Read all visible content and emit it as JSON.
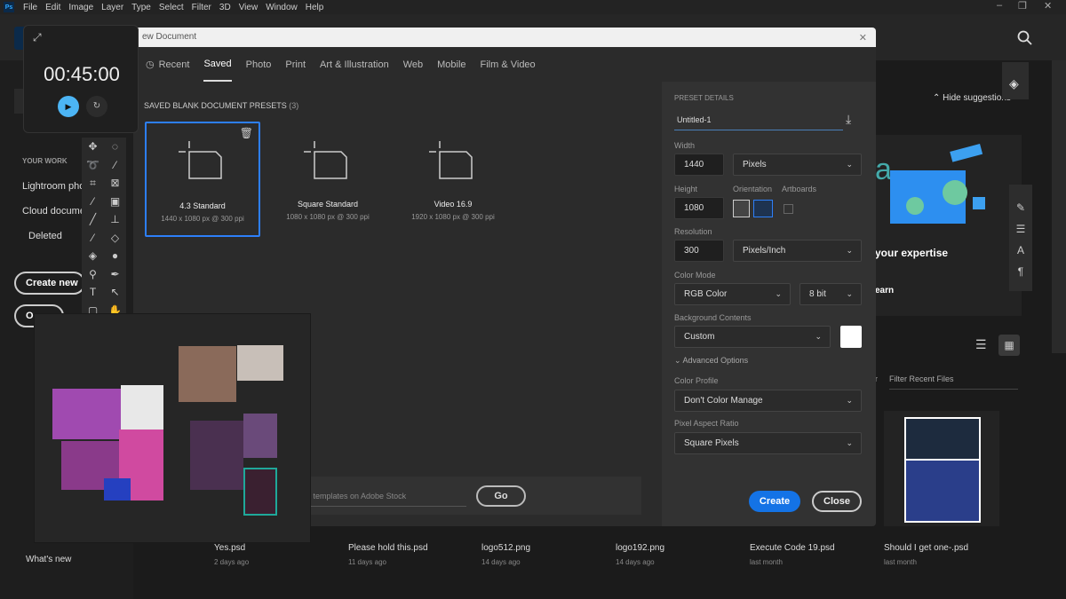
{
  "menubar": {
    "logo": "Ps",
    "items": [
      "File",
      "Edit",
      "Image",
      "Layer",
      "Type",
      "Select",
      "Filter",
      "3D",
      "View",
      "Window",
      "Help"
    ]
  },
  "window_controls": {
    "minimize": "–",
    "restore": "❐",
    "close": "✕"
  },
  "timer": {
    "time": "00:45:00",
    "play_icon": "play-icon",
    "reset_icon": "reset-icon"
  },
  "sidebar": {
    "section": "YOUR WORK",
    "items": [
      "Lightroom pho",
      "Cloud docume",
      "Deleted"
    ],
    "create_new": "Create new",
    "open": "O",
    "whats_new": "What's new"
  },
  "dialog": {
    "title": "ew Document",
    "close": "✕",
    "tabs": [
      {
        "label": "Recent"
      },
      {
        "label": "Saved",
        "active": true
      },
      {
        "label": "Photo"
      },
      {
        "label": "Print"
      },
      {
        "label": "Art & Illustration"
      },
      {
        "label": "Web"
      },
      {
        "label": "Mobile"
      },
      {
        "label": "Film & Video"
      }
    ],
    "presets_heading": "SAVED BLANK DOCUMENT PRESETS",
    "presets_count": "(3)",
    "presets": [
      {
        "name": "4.3 Standard",
        "size": "1440 x 1080 px @ 300 ppi",
        "selected": true
      },
      {
        "name": "Square Standard",
        "size": "1080 x 1080 px @ 300 ppi"
      },
      {
        "name": "Video 16.9",
        "size": "1920 x 1080 px @ 300 ppi"
      }
    ],
    "search_placeholder": "e templates on Adobe Stock",
    "go": "Go",
    "details": {
      "heading": "PRESET DETAILS",
      "name": "Untitled-1",
      "width_label": "Width",
      "width": "1440",
      "width_unit": "Pixels",
      "height_label": "Height",
      "height": "1080",
      "orientation_label": "Orientation",
      "orientation": "landscape",
      "artboards_label": "Artboards",
      "artboards": false,
      "resolution_label": "Resolution",
      "resolution": "300",
      "resolution_unit": "Pixels/Inch",
      "color_mode_label": "Color Mode",
      "color_mode": "RGB Color",
      "bit_depth": "8 bit",
      "background_label": "Background Contents",
      "background": "Custom",
      "background_color": "#ffffff",
      "advanced": "Advanced Options",
      "color_profile_label": "Color Profile",
      "color_profile": "Don't Color Manage",
      "pixel_aspect_label": "Pixel Aspect Ratio",
      "pixel_aspect": "Square Pixels",
      "create": "Create",
      "close": "Close"
    }
  },
  "home": {
    "hide_suggestions": "Hide suggestions",
    "card_title": "your expertise",
    "card_link": "earn",
    "filter": "Filter Recent Files",
    "filter_prefix": "r"
  },
  "recent_files": [
    {
      "name": "Yes.psd",
      "date": "2 days ago"
    },
    {
      "name": "Please hold this.psd",
      "date": "11 days ago"
    },
    {
      "name": "logo512.png",
      "date": "14 days ago"
    },
    {
      "name": "logo192.png",
      "date": "14 days ago"
    },
    {
      "name": "Execute Code 19.psd",
      "date": "last month"
    },
    {
      "name": "Should I get one-.psd",
      "date": "last month"
    }
  ],
  "colors": {
    "accent": "#2d7ff9",
    "timer_play": "#4cb5f5"
  }
}
